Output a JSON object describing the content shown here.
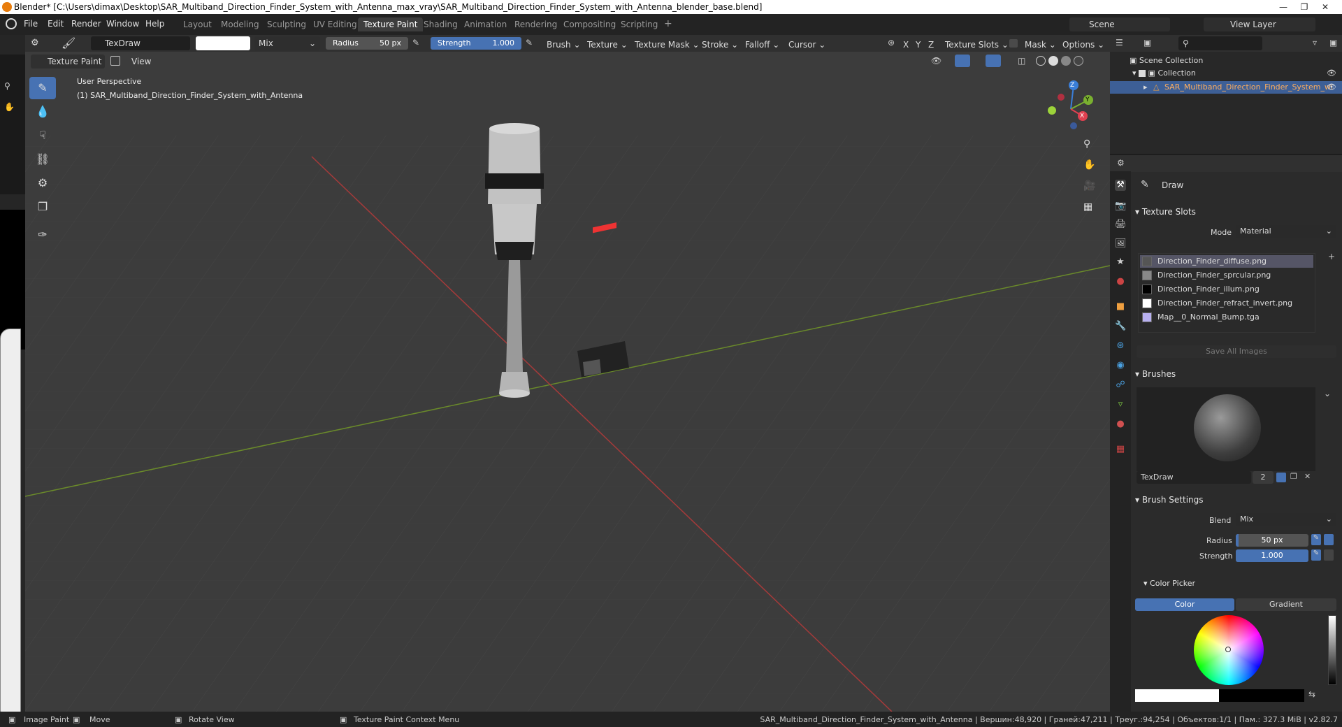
{
  "title": "Blender* [C:\\Users\\dimax\\Desktop\\SAR_Multiband_Direction_Finder_System_with_Antenna_max_vray\\SAR_Multiband_Direction_Finder_System_with_Antenna_blender_base.blend]",
  "menu": [
    "File",
    "Edit",
    "Render",
    "Window",
    "Help"
  ],
  "workspaces": [
    "Layout",
    "Modeling",
    "Sculpting",
    "UV Editing",
    "Texture Paint",
    "Shading",
    "Animation",
    "Rendering",
    "Compositing",
    "Scripting"
  ],
  "active_workspace": "Texture Paint",
  "scene": "Scene",
  "view_layer": "View Layer",
  "toolhdr": {
    "brush_name": "TexDraw",
    "blend": "Mix",
    "radius_label": "Radius",
    "radius_value": "50 px",
    "strength_label": "Strength",
    "strength_value": "1.000",
    "menus": [
      "Brush",
      "Texture",
      "Texture Mask",
      "Stroke",
      "Falloff",
      "Cursor"
    ],
    "axes": [
      "X",
      "Y",
      "Z"
    ],
    "texture_slots": "Texture Slots",
    "mask": "Mask",
    "options": "Options"
  },
  "viewport": {
    "mode": "Texture Paint",
    "view_menu": "View",
    "perspective": "User Perspective",
    "object_label": "(1) SAR_Multiband_Direction_Finder_System_with_Antenna"
  },
  "outliner": {
    "scene_collection": "Scene Collection",
    "collection": "Collection",
    "object": "SAR_Multiband_Direction_Finder_System_wi"
  },
  "props": {
    "tool_name": "Draw",
    "texture_slots_title": "Texture Slots",
    "mode_label": "Mode",
    "mode_value": "Material",
    "slots": [
      {
        "name": "Direction_Finder_diffuse.png",
        "color": "#555555"
      },
      {
        "name": "Direction_Finder_sprcular.png",
        "color": "#888888"
      },
      {
        "name": "Direction_Finder_illum.png",
        "color": "#000000"
      },
      {
        "name": "Direction_Finder_refract_invert.png",
        "color": "#ffffff"
      },
      {
        "name": "Map__0_Normal_Bump.tga",
        "color": "#b8b0f0"
      }
    ],
    "save_all": "Save All Images",
    "brushes_title": "Brushes",
    "brush_name": "TexDraw",
    "brush_users": "2",
    "brush_settings_title": "Brush Settings",
    "blend_label": "Blend",
    "blend_value": "Mix",
    "radius_label": "Radius",
    "radius_value": "50 px",
    "strength_label": "Strength",
    "strength_value": "1.000",
    "color_picker_title": "Color Picker",
    "color_tab": "Color",
    "gradient_tab": "Gradient"
  },
  "status": {
    "image_paint": "Image Paint",
    "move": "Move",
    "rotate": "Rotate View",
    "context": "Texture Paint Context Menu",
    "stats": "SAR_Multiband_Direction_Finder_System_with_Antenna | Вершин:48,920 | Граней:47,211 | Треуг.:94,254 | Объектов:1/1 | Пам.: 327.3 MiB | v2.82.7"
  },
  "colors": {
    "accent": "#4772b3",
    "x_axis": "#e04050",
    "y_axis": "#7ab030",
    "z_axis": "#3a7ed8"
  }
}
